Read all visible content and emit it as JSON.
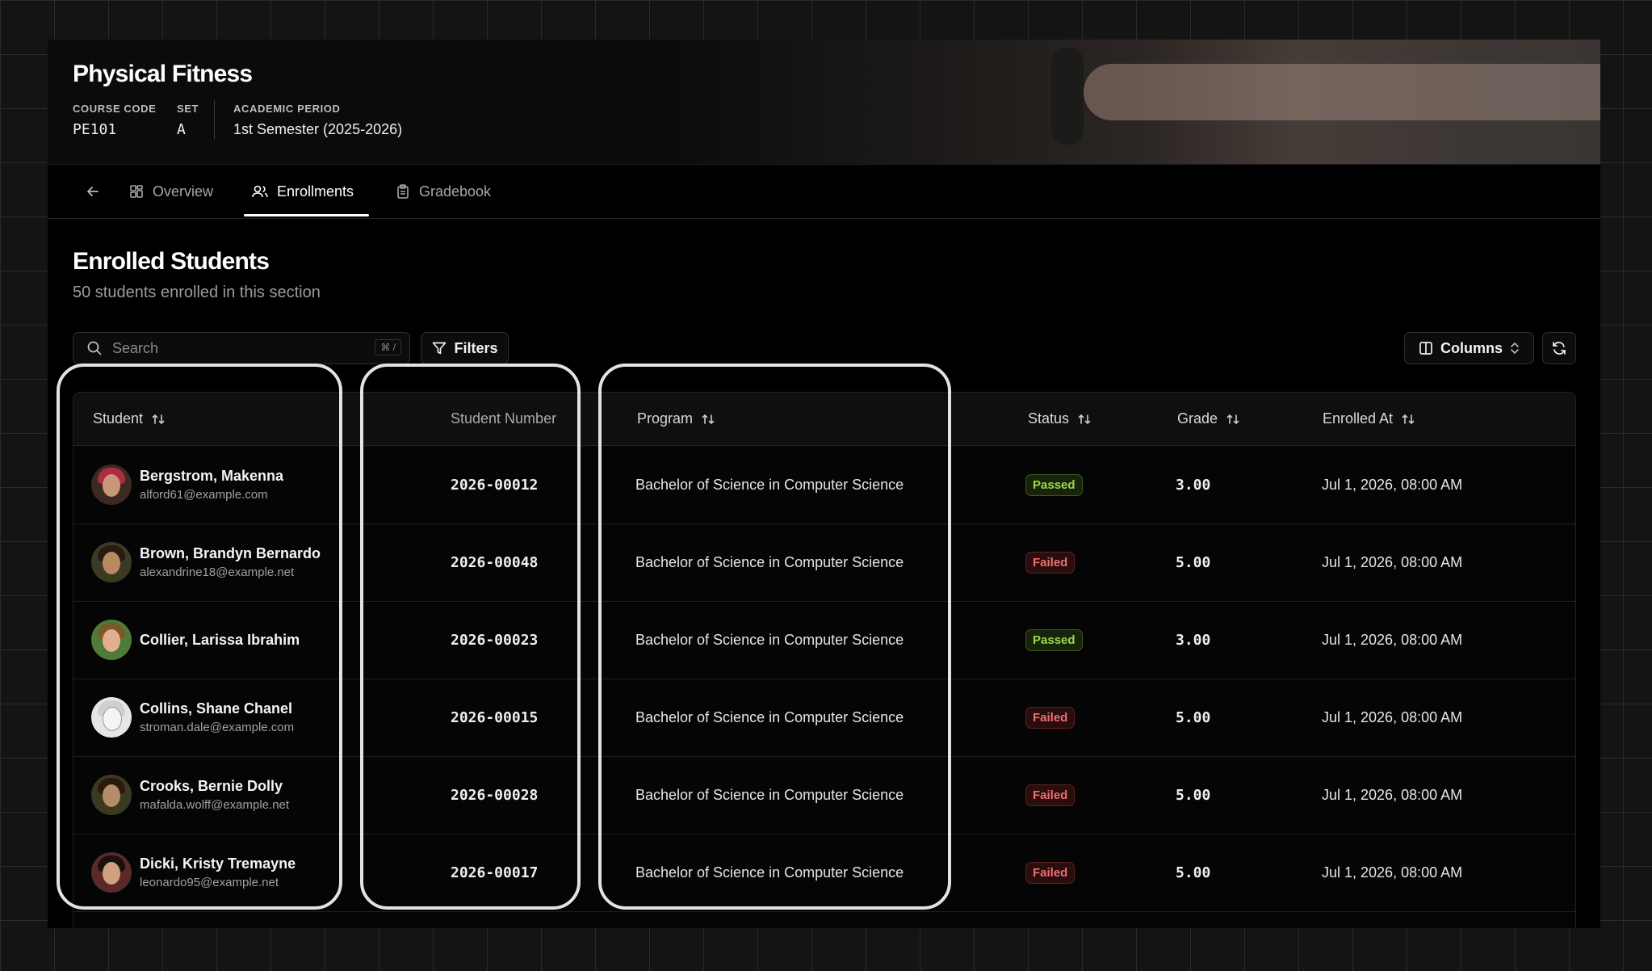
{
  "course": {
    "title": "Physical Fitness",
    "code_label": "COURSE CODE",
    "code": "PE101",
    "set_label": "SET",
    "set": "A",
    "period_label": "ACADEMIC PERIOD",
    "period": "1st Semester (2025-2026)"
  },
  "tabs": [
    {
      "label": "Overview",
      "icon": "grid-icon"
    },
    {
      "label": "Enrollments",
      "icon": "users-icon",
      "active": true
    },
    {
      "label": "Gradebook",
      "icon": "clipboard-icon"
    }
  ],
  "section": {
    "title": "Enrolled Students",
    "subtitle": "50 students enrolled in this section"
  },
  "toolbar": {
    "search_placeholder": "Search",
    "search_shortcut": "⌘ /",
    "filters_label": "Filters",
    "columns_label": "Columns"
  },
  "table": {
    "headers": {
      "student": "Student",
      "student_number": "Student Number",
      "program": "Program",
      "status": "Status",
      "grade": "Grade",
      "enrolled_at": "Enrolled At"
    },
    "rows": [
      {
        "name": "Bergstrom, Makenna",
        "email": "alford61@example.com",
        "number": "2026-00012",
        "program": "Bachelor of Science in Computer Science",
        "status": "Passed",
        "grade": "3.00",
        "enrolled_at": "Jul 1, 2026, 08:00 AM"
      },
      {
        "name": "Brown, Brandyn Bernardo",
        "email": "alexandrine18@example.net",
        "number": "2026-00048",
        "program": "Bachelor of Science in Computer Science",
        "status": "Failed",
        "grade": "5.00",
        "enrolled_at": "Jul 1, 2026, 08:00 AM"
      },
      {
        "name": "Collier, Larissa Ibrahim",
        "email": "",
        "number": "2026-00023",
        "program": "Bachelor of Science in Computer Science",
        "status": "Passed",
        "grade": "3.00",
        "enrolled_at": "Jul 1, 2026, 08:00 AM"
      },
      {
        "name": "Collins, Shane Chanel",
        "email": "stroman.dale@example.com",
        "number": "2026-00015",
        "program": "Bachelor of Science in Computer Science",
        "status": "Failed",
        "grade": "5.00",
        "enrolled_at": "Jul 1, 2026, 08:00 AM"
      },
      {
        "name": "Crooks, Bernie Dolly",
        "email": "mafalda.wolff@example.net",
        "number": "2026-00028",
        "program": "Bachelor of Science in Computer Science",
        "status": "Failed",
        "grade": "5.00",
        "enrolled_at": "Jul 1, 2026, 08:00 AM"
      },
      {
        "name": "Dicki, Kristy Tremayne",
        "email": "leonardo95@example.net",
        "number": "2026-00017",
        "program": "Bachelor of Science in Computer Science",
        "status": "Failed",
        "grade": "5.00",
        "enrolled_at": "Jul 1, 2026, 08:00 AM"
      }
    ]
  },
  "colors": {
    "passed": "#9ad94a",
    "failed": "#f07070",
    "background": "#000000",
    "grid": "#2b2b2b"
  }
}
